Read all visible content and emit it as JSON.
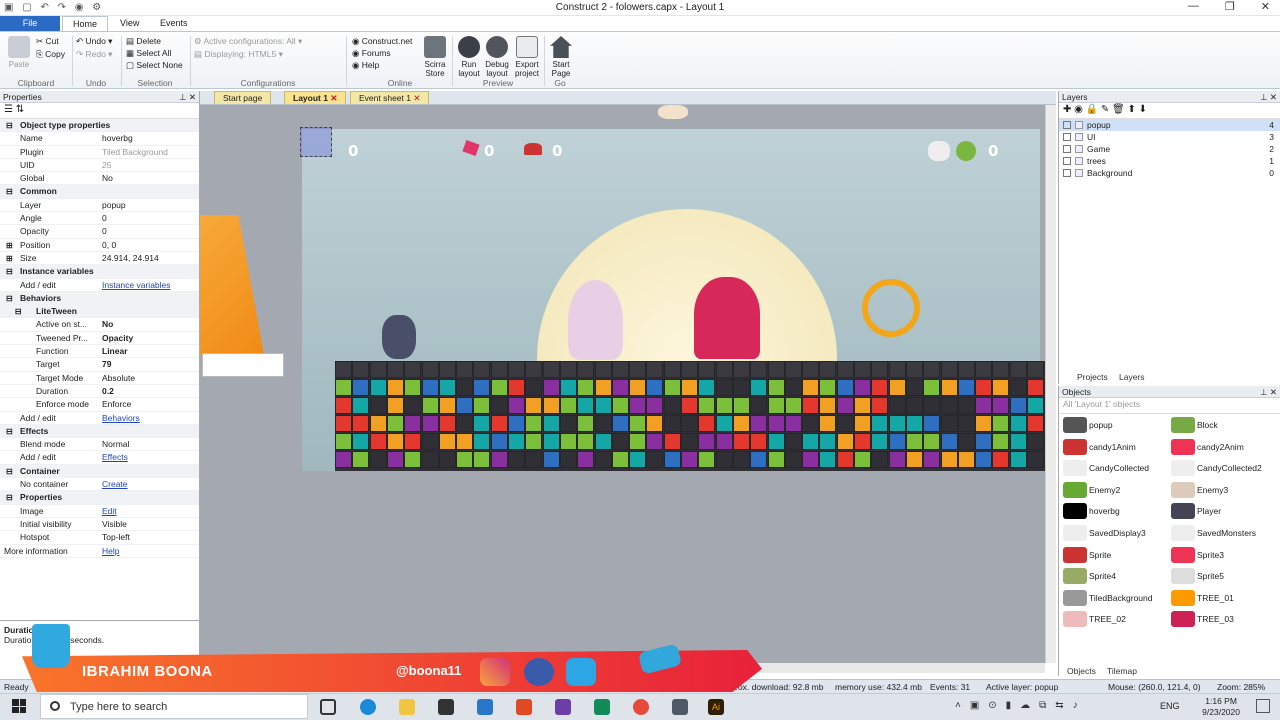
{
  "window": {
    "title": "Construct 2 - folowers.capx - Layout 1"
  },
  "ribbon": {
    "tabs": [
      "File",
      "Home",
      "View",
      "Events"
    ],
    "clipboard": {
      "cut": "Cut",
      "copy": "Copy",
      "paste": "Paste",
      "group": "Clipboard"
    },
    "undo": {
      "undo": "Undo",
      "redo": "Redo",
      "group": "Undo"
    },
    "selection": {
      "delete": "Delete",
      "select_all": "Select All",
      "select_none": "Select None",
      "group": "Selection"
    },
    "configurations": {
      "active": "Active configurations: All",
      "displaying": "Displaying: HTML5",
      "group": "Configurations"
    },
    "online": {
      "construct_net": "Construct.net",
      "forums": "Forums",
      "help": "Help",
      "group": "Online"
    },
    "store": {
      "label1": "Scirra",
      "label2": "Store"
    },
    "preview": {
      "run1": "Run",
      "run2": "layout",
      "debug1": "Debug",
      "debug2": "layout",
      "export1": "Export",
      "export2": "project",
      "group": "Preview"
    },
    "go": {
      "start1": "Start",
      "start2": "Page",
      "group": "Go"
    }
  },
  "properties": {
    "title": "Properties",
    "rows": [
      {
        "type": "cat",
        "k": "Object type properties"
      },
      {
        "k": "Name",
        "v": "hoverbg"
      },
      {
        "k": "Plugin",
        "v": "Tiled Background",
        "grey": true
      },
      {
        "k": "UID",
        "v": "25",
        "grey": true
      },
      {
        "k": "Global",
        "v": "No"
      },
      {
        "type": "cat",
        "k": "Common"
      },
      {
        "k": "Layer",
        "v": "popup"
      },
      {
        "k": "Angle",
        "v": "0"
      },
      {
        "k": "Opacity",
        "v": "0"
      },
      {
        "k": "Position",
        "v": "0, 0",
        "plus": true
      },
      {
        "k": "Size",
        "v": "24.914, 24.914",
        "plus": true
      },
      {
        "type": "cat",
        "k": "Instance variables"
      },
      {
        "k": "Add / edit",
        "v": "Instance variables",
        "link": true
      },
      {
        "type": "cat",
        "k": "Behaviors"
      },
      {
        "type": "subcat",
        "k": "LiteTween"
      },
      {
        "k": "Active on st...",
        "v": "No",
        "sub": true,
        "bold": true
      },
      {
        "k": "Tweened Pr...",
        "v": "Opacity",
        "sub": true,
        "bold": true
      },
      {
        "k": "Function",
        "v": "Linear",
        "sub": true,
        "bold": true
      },
      {
        "k": "Target",
        "v": "79",
        "sub": true,
        "bold": true
      },
      {
        "k": "Target Mode",
        "v": "Absolute",
        "sub": true
      },
      {
        "k": "Duration",
        "v": "0.2",
        "sub": true,
        "bold": true
      },
      {
        "k": "Enforce mode",
        "v": "Enforce",
        "sub": true
      },
      {
        "k": "Add / edit",
        "v": "Behaviors",
        "link": true
      },
      {
        "type": "cat",
        "k": "Effects"
      },
      {
        "k": "Blend mode",
        "v": "Normal"
      },
      {
        "k": "Add / edit",
        "v": "Effects",
        "link": true
      },
      {
        "type": "cat",
        "k": "Container"
      },
      {
        "k": "No container",
        "v": "Create",
        "link": true
      },
      {
        "type": "cat",
        "k": "Properties"
      },
      {
        "k": "Image",
        "v": "Edit",
        "link": true
      },
      {
        "k": "Initial visibility",
        "v": "Visible"
      },
      {
        "k": "Hotspot",
        "v": "Top-left"
      },
      {
        "k": "More information",
        "v": "Help",
        "link": true,
        "root": true
      }
    ],
    "desc_title": "Duration",
    "desc_text": "Duration given in seconds."
  },
  "doc_tabs": [
    "Start page",
    "Layout 1",
    "Event sheet 1"
  ],
  "hud": {
    "c1": "0",
    "c2": "0",
    "c3": "0",
    "c4": "0"
  },
  "layers": {
    "title": "Layers",
    "items": [
      {
        "name": "popup",
        "n": "4"
      },
      {
        "name": "UI",
        "n": "3"
      },
      {
        "name": "Game",
        "n": "2"
      },
      {
        "name": "trees",
        "n": "1"
      },
      {
        "name": "Background",
        "n": "0"
      }
    ],
    "tabs": [
      "Projects",
      "Layers"
    ]
  },
  "objects": {
    "title": "Objects",
    "filter": "All 'Layout 1' objects",
    "items": [
      {
        "name": "popup",
        "color": "#555"
      },
      {
        "name": "Block",
        "color": "#7a4"
      },
      {
        "name": "candy1Anim",
        "color": "#c33"
      },
      {
        "name": "candy2Anim",
        "color": "#e35"
      },
      {
        "name": "CandyCollected",
        "color": "#eee"
      },
      {
        "name": "CandyCollected2",
        "color": "#eee"
      },
      {
        "name": "Enemy2",
        "color": "#6a3"
      },
      {
        "name": "Enemy3",
        "color": "#dcb"
      },
      {
        "name": "hoverbg",
        "color": "#000"
      },
      {
        "name": "Player",
        "color": "#445"
      },
      {
        "name": "SavedDisplay3",
        "color": "#eee"
      },
      {
        "name": "SavedMonsters",
        "color": "#eee"
      },
      {
        "name": "Sprite",
        "color": "#c33"
      },
      {
        "name": "Sprite3",
        "color": "#e35"
      },
      {
        "name": "Sprite4",
        "color": "#9a6"
      },
      {
        "name": "Sprite5",
        "color": "#ddd"
      },
      {
        "name": "TiledBackground",
        "color": "#999"
      },
      {
        "name": "TREE_01",
        "color": "#f90"
      },
      {
        "name": "TREE_02",
        "color": "#ebb"
      },
      {
        "name": "TREE_03",
        "color": "#c25"
      }
    ],
    "tabs": [
      "Objects",
      "Tilemap"
    ]
  },
  "status": {
    "ready": "Ready",
    "download": "Approx. download: 92.8 mb",
    "memory": "memory use: 432.4 mb",
    "events": "Events: 31",
    "active_layer": "Active layer: popup",
    "mouse": "Mouse: (260.0, 121.4, 0)",
    "zoom": "Zoom: 285%"
  },
  "banner": {
    "name": "IBRAHIM BOONA",
    "handle": "@boona11"
  },
  "taskbar": {
    "search": "Type here to search",
    "lang": "ENG",
    "time": "1:16 PM",
    "date": "9/23/2020"
  }
}
